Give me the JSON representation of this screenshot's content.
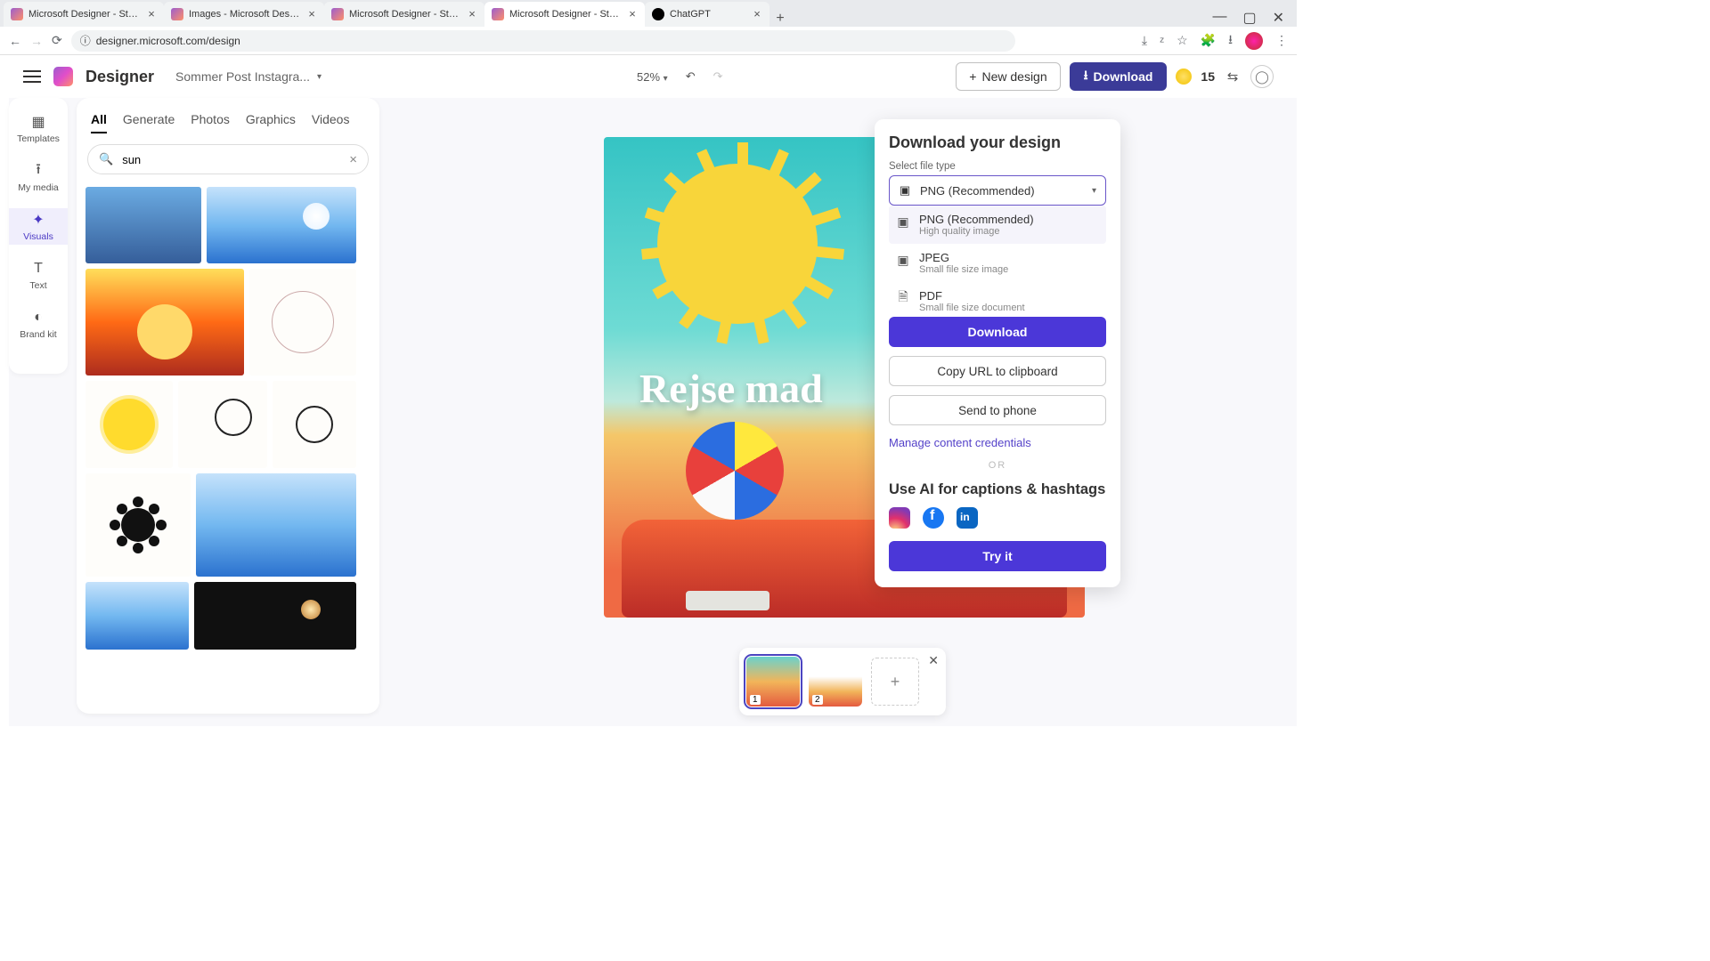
{
  "browser": {
    "tabs": [
      {
        "title": "Microsoft Designer - Stunning"
      },
      {
        "title": "Images - Microsoft Designer"
      },
      {
        "title": "Microsoft Designer - Stunning"
      },
      {
        "title": "Microsoft Designer - Stunning",
        "active": true
      },
      {
        "title": "ChatGPT"
      }
    ],
    "url": "designer.microsoft.com/design"
  },
  "header": {
    "app_name": "Designer",
    "doc_name": "Sommer Post Instagra...",
    "zoom": "52%",
    "new_design": "New design",
    "download": "Download",
    "coins": "15"
  },
  "rail": {
    "items": [
      "Templates",
      "My media",
      "Visuals",
      "Text",
      "Brand kit"
    ]
  },
  "visuals": {
    "tabs": [
      "All",
      "Generate",
      "Photos",
      "Graphics",
      "Videos"
    ],
    "search": "sun"
  },
  "canvas": {
    "text": "Rejse mad"
  },
  "pages": {
    "p1": "1",
    "p2": "2"
  },
  "download_panel": {
    "title": "Download your design",
    "subtitle": "Select file type",
    "selected": "PNG (Recommended)",
    "options": [
      {
        "name": "PNG (Recommended)",
        "desc": "High quality image",
        "icon": "image"
      },
      {
        "name": "JPEG",
        "desc": "Small file size image",
        "icon": "image"
      },
      {
        "name": "PDF",
        "desc": "Small file size document",
        "icon": "pdf"
      }
    ],
    "download_btn": "Download",
    "copy_btn": "Copy URL to clipboard",
    "send_btn": "Send to phone",
    "manage_link": "Manage content credentials",
    "or": "OR",
    "ai_title": "Use AI for captions & hashtags",
    "try_btn": "Try it"
  }
}
